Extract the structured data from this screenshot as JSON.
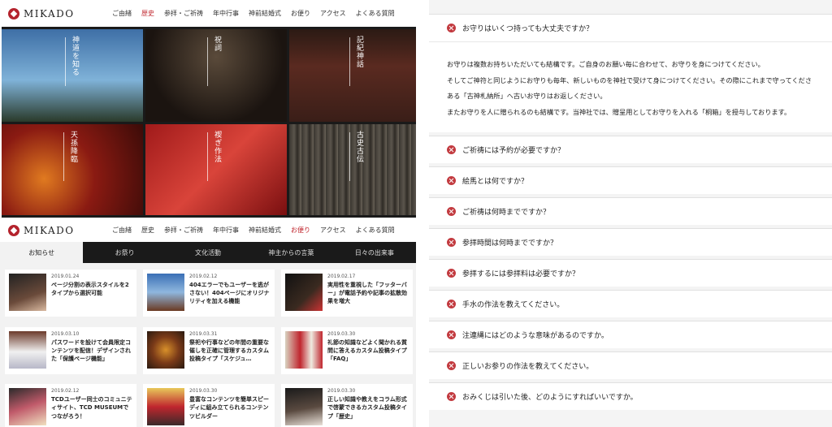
{
  "site": {
    "logo_text": "MIKADO"
  },
  "nav": [
    "ご由緒",
    "歴史",
    "参拝・ご祈祷",
    "年中行事",
    "神前結婚式",
    "お便り",
    "アクセス",
    "よくある質問"
  ],
  "nav_active_top": 1,
  "nav_active_bottom": 5,
  "tiles": [
    {
      "label": "神道を知る"
    },
    {
      "label": "祝詞"
    },
    {
      "label": "記紀神話"
    },
    {
      "label": "天孫降臨"
    },
    {
      "label": "禊ぎ作法"
    },
    {
      "label": "古史古伝"
    }
  ],
  "tabs": [
    "お知らせ",
    "お祭り",
    "文化活動",
    "神主からの言葉",
    "日々の出来事"
  ],
  "posts": [
    {
      "date": "2019.01.24",
      "title": "ページ分割の表示スタイルを2タイプから選択可能"
    },
    {
      "date": "2019.02.12",
      "title": "404エラーでもユーザーを逃がさない！404ページにオリジナリティを加える機能"
    },
    {
      "date": "2019.02.17",
      "title": "実用性を重視した「フッターバー」が電話予約や記事の拡散効果を増大"
    },
    {
      "date": "2019.03.10",
      "title": "パスワードを設けて会員限定コンテンツを配信！デザインされた「保護ページ機能」"
    },
    {
      "date": "2019.03.31",
      "title": "祭祀や行事などの年間の重要な催しを正確に管理するカスタム投稿タイプ「スケジュ…"
    },
    {
      "date": "2019.03.30",
      "title": "礼節の知識などよく聞かれる質問に答えるカスタム投稿タイプ「FAQ」"
    },
    {
      "date": "2019.02.12",
      "title": "TCDユーザー同士のコミュニティサイト、TCD MUSEUMでつながろう！"
    },
    {
      "date": "2019.03.30",
      "title": "豊富なコンテンツを簡単スピーディに組み立てられるコンテンツビルダー"
    },
    {
      "date": "2019.03.30",
      "title": "正しい知識や教えをコラム形式で啓蒙できるカスタム投稿タイプ「歴史」"
    }
  ],
  "faq": {
    "open_question": "お守りはいくつ持っても大丈夫ですか？",
    "answer_lines": [
      "お守りは複数お持ちいただいても結構です。ご自身のお願い毎に合わせて、お守りを身につけてください。",
      "そしてご神符と同じようにお守りも毎年、新しいものを神社で受けて身につけてください。その際にこれまで守ってくださ",
      "ある「古神札納所」へ古いお守りはお返しください。",
      "またお守りを人に贈られるのも結構です。当神社では、贈呈用としてお守りを入れる「桐箱」を授与しております。"
    ],
    "questions": [
      "ご祈祷には予約が必要ですか？",
      "絵馬とは何ですか？",
      "ご祈祷は何時までですか？",
      "参拝時間は何時までですか？",
      "参拝するには参拝料は必要ですか？",
      "手水の作法を教えてください。",
      "注連縄にはどのような意味があるのですか。",
      "正しいお参りの作法を教えてください。",
      "おみくじは引いた後、どのようにすればいいですか。"
    ]
  },
  "colors": {
    "accent": "#c0262e",
    "dark": "#1a1a1a",
    "faq_bg": "#f4f4f4"
  }
}
